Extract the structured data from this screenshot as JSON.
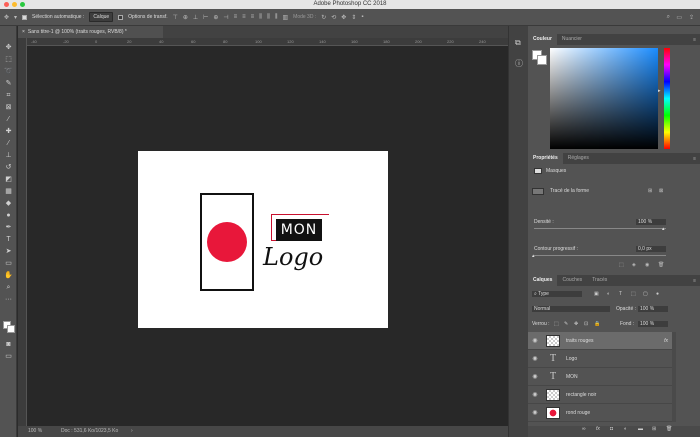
{
  "window": {
    "title": "Adobe Photoshop CC 2018",
    "traffic_colors": [
      "#fc5f57",
      "#fdbc2e",
      "#2ac940"
    ]
  },
  "options_bar": {
    "auto_select_label": "Sélection automatique :",
    "auto_select_value": "Calque",
    "transform_label": "Options de transf.",
    "mode3d_label": "Mode 3D :"
  },
  "document": {
    "tab_title": "Sans titre-1 @ 100% (traits rouges, RVB/8) *",
    "ruler_ticks": [
      "-40",
      "-20",
      "0",
      "20",
      "40",
      "60",
      "80",
      "100",
      "120",
      "140",
      "160",
      "180",
      "200",
      "220",
      "240"
    ],
    "zoom": "100 %",
    "doc_info": "Doc : 531,6 Ko/1023,5 Ko"
  },
  "canvas_art": {
    "mon_text": "MON",
    "logo_text": "Logo",
    "circle_color": "#e8173a",
    "accent_line_color": "#c8102e"
  },
  "color_panel": {
    "tabs": [
      "Couleur",
      "Nuancier"
    ],
    "active_tab": "Couleur"
  },
  "properties_panel": {
    "tabs": [
      "Propriétés",
      "Réglages"
    ],
    "section": "Masques",
    "vector_mask": "Tracé de la forme",
    "density_label": "Densité :",
    "density_value": "100 %",
    "feather_label": "Contour progressif :",
    "feather_value": "0,0 px"
  },
  "layers_panel": {
    "tabs": [
      "Calques",
      "Couches",
      "Tracés"
    ],
    "filter": "Type",
    "blend_mode": "Normal",
    "opacity_label": "Opacité :",
    "opacity_value": "100 %",
    "lock_label": "Verrou :",
    "fill_label": "Fond :",
    "fill_value": "100 %",
    "layers": [
      {
        "name": "traits rouges",
        "kind": "pixel",
        "selected": true,
        "fx": "fx"
      },
      {
        "name": "Logo",
        "kind": "text",
        "selected": false
      },
      {
        "name": "MON",
        "kind": "text",
        "selected": false
      },
      {
        "name": "rectangle noir",
        "kind": "pixel",
        "selected": false
      },
      {
        "name": "rond rouge",
        "kind": "pixel",
        "selected": false
      }
    ]
  }
}
